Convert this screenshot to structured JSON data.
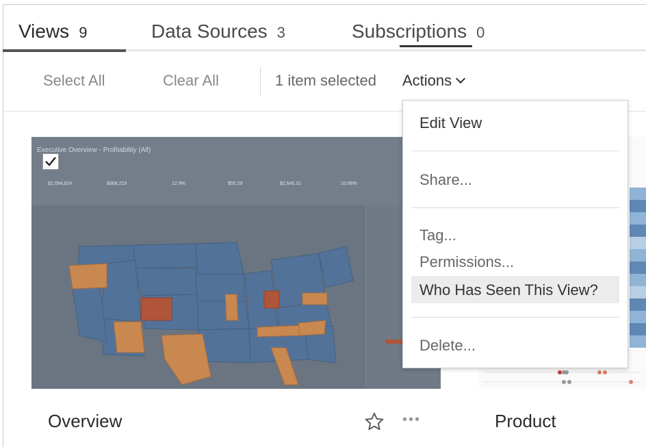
{
  "tabs": [
    {
      "label": "Views",
      "count": "9"
    },
    {
      "label": "Data Sources",
      "count": "3"
    },
    {
      "label": "Subscriptions",
      "count": "0"
    }
  ],
  "toolbar": {
    "select_all": "Select All",
    "clear_all": "Clear All",
    "selection_status": "1 item selected",
    "actions": "Actions"
  },
  "menu": {
    "items": [
      "Edit View",
      "Share...",
      "Tag...",
      "Permissions...",
      "Who Has Seen This View?",
      "Delete..."
    ],
    "highlighted_index": 4
  },
  "cards": [
    {
      "title": "Overview",
      "selected": true,
      "thumbnail": {
        "title": "Executive Overview - Profitability (All)",
        "kpi_values": [
          "$2,094,824",
          "$368,219",
          "12.9%",
          "$55.29",
          "$2,645.31",
          "10.68%"
        ]
      }
    },
    {
      "title": "Product"
    }
  ],
  "colors": {
    "tab_indicator": "#555555",
    "menu_highlight": "#ececec",
    "map_blue": "#5a7aa3",
    "map_orange": "#c98850",
    "map_red": "#b0553a"
  }
}
